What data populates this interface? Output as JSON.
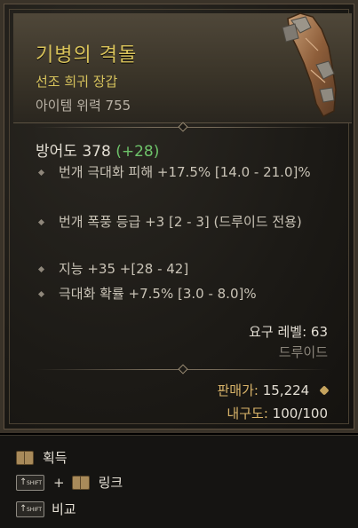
{
  "item": {
    "name": "기병의 격돌",
    "rarity": "선조 희귀 장갑",
    "power": "아이템 위력 755",
    "armor_label": "방어도 378",
    "armor_bonus": "(+28)",
    "affixes": [
      "번개 극대화 피해 +17.5% [14.0 - 21.0]%",
      "번개 폭풍 등급 +3 [2 - 3] (드루이드 전용)",
      "지능 +35 +[28 - 42]",
      "극대화 확률 +7.5% [3.0 - 8.0]%"
    ],
    "requirement": "요구 레벨: 63",
    "class": "드루이드",
    "sell_label": "판매가:",
    "sell_value": "15,224",
    "durability_label": "내구도:",
    "durability_value": "100/100"
  },
  "footer": {
    "acquire": "획득",
    "link": "링크",
    "compare": "비교",
    "shift_key": "SHIFT",
    "plus": "+"
  },
  "colors": {
    "title": "#d8c25a",
    "bonus": "#6ec36a",
    "affix_text": "#c9c3b6",
    "sell_label": "#d9b46a"
  }
}
